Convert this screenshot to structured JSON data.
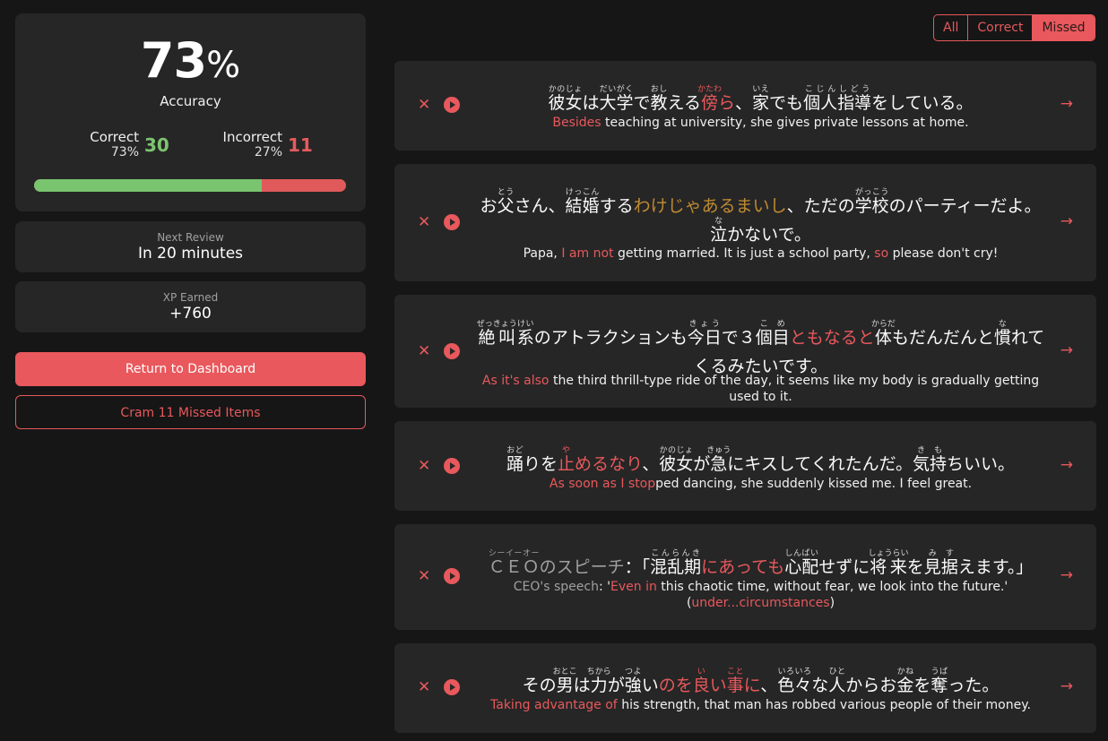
{
  "summary": {
    "accuracy_number": "73",
    "accuracy_sign": "%",
    "accuracy_label": "Accuracy",
    "correct_label": "Correct",
    "correct_pct": "73%",
    "correct_count": "30",
    "incorrect_label": "Incorrect",
    "incorrect_pct": "27%",
    "incorrect_count": "11",
    "bar_correct_fraction": 0.73
  },
  "next_review": {
    "label": "Next Review",
    "value": "In 20 minutes"
  },
  "xp": {
    "label": "XP Earned",
    "value": "+760"
  },
  "buttons": {
    "dashboard": "Return to Dashboard",
    "cram": "Cram 11 Missed Items"
  },
  "filters": {
    "all": "All",
    "correct": "Correct",
    "missed": "Missed",
    "active": "Missed"
  },
  "icons": {
    "remove": "close-icon",
    "play": "play-icon",
    "open": "arrow-right-icon"
  },
  "colors": {
    "accent": "#e8585c",
    "correct": "#7dc471",
    "grammar_highlight": "#c08a32",
    "panel": "#262626",
    "background": "#161616"
  },
  "cards": [
    {
      "jp": [
        {
          "r": "彼女",
          "rt": "かのじょ"
        },
        {
          "t": "は"
        },
        {
          "r": "大学",
          "rt": "だいがく"
        },
        {
          "t": "で"
        },
        {
          "r": "教",
          "rt": "おし"
        },
        {
          "t": "える"
        },
        {
          "r": "傍",
          "rt": "かたわ",
          "hl": 1
        },
        {
          "t": "ら",
          "hl": 1
        },
        {
          "t": "、"
        },
        {
          "r": "家",
          "rt": "いえ"
        },
        {
          "t": "でも"
        },
        {
          "r": "個人指導",
          "rt": "こじんしどう"
        },
        {
          "t": "をしている。"
        }
      ],
      "en": [
        {
          "t": "Besides",
          "hl": 1
        },
        {
          "t": " teaching at university, she gives private lessons at home."
        }
      ]
    },
    {
      "jp": [
        {
          "t": "お"
        },
        {
          "r": "父",
          "rt": "とう"
        },
        {
          "t": "さん、"
        },
        {
          "r": "結婚",
          "rt": "けっこん"
        },
        {
          "t": "する"
        },
        {
          "t": "わけじゃあるまいし",
          "hl": 2
        },
        {
          "t": "、ただの"
        },
        {
          "r": "学校",
          "rt": "がっこう"
        },
        {
          "t": "のパーティーだよ。"
        },
        {
          "r": "泣",
          "rt": "な"
        },
        {
          "t": "かないで。"
        }
      ],
      "en": [
        {
          "t": "Papa, "
        },
        {
          "t": "I am not",
          "hl": 1
        },
        {
          "t": " getting married. It is just a school party, "
        },
        {
          "t": "so",
          "hl": 1
        },
        {
          "t": " please don't cry!"
        }
      ]
    },
    {
      "jp": [
        {
          "r": "絶叫",
          "rt": "ぜっきょう"
        },
        {
          "r": "系",
          "rt": "けい"
        },
        {
          "t": "のアトラクションも"
        },
        {
          "r": "今日",
          "rt": "きょう"
        },
        {
          "t": "で３"
        },
        {
          "r": "個目",
          "rt": "こめ"
        },
        {
          "t": "ともなると",
          "hl": 1
        },
        {
          "r": "体",
          "rt": "からだ"
        },
        {
          "t": "もだんだんと"
        },
        {
          "r": "慣",
          "rt": "な"
        },
        {
          "t": "れてくるみたいです。"
        }
      ],
      "en": [
        {
          "t": "As it's also",
          "hl": 1
        },
        {
          "t": " the third thrill-type ride of the day, it seems like my body is gradually getting used to it."
        }
      ]
    },
    {
      "jp": [
        {
          "r": "踊",
          "rt": "おど"
        },
        {
          "t": "りを"
        },
        {
          "r": "止",
          "rt": "や",
          "hl": 1
        },
        {
          "t": "めるなり",
          "hl": 1
        },
        {
          "t": "、"
        },
        {
          "r": "彼女",
          "rt": "かのじょ"
        },
        {
          "t": "が"
        },
        {
          "r": "急",
          "rt": "きゅう"
        },
        {
          "t": "にキスしてくれたんだ。"
        },
        {
          "r": "気持",
          "rt": "きも"
        },
        {
          "t": "ちいい。"
        }
      ],
      "en": [
        {
          "t": "As soon as I stop",
          "hl": 1
        },
        {
          "t": "ped dancing, she suddenly kissed me. I feel great."
        }
      ]
    },
    {
      "jp": [
        {
          "r": "ＣＥＯ",
          "rt": "シーイーオー",
          "dim": 1
        },
        {
          "t": "のスピーチ",
          "dim": 1
        },
        {
          "t": "：「"
        },
        {
          "r": "混乱期",
          "rt": "こんらんき"
        },
        {
          "t": "にあっても",
          "hl": 1
        },
        {
          "r": "心配",
          "rt": "しんぱい"
        },
        {
          "t": "せずに"
        },
        {
          "r": "将来",
          "rt": "しょうらい"
        },
        {
          "t": "を"
        },
        {
          "r": "見",
          "rt": "み"
        },
        {
          "r": "据",
          "rt": "す"
        },
        {
          "t": "えます。」"
        }
      ],
      "en": [
        {
          "t": "CEO's speech",
          "dim": 1
        },
        {
          "t": ": '"
        },
        {
          "t": "Even in",
          "hl": 1
        },
        {
          "t": " this chaotic time, without fear, we look into the future.' ("
        },
        {
          "t": "under...circumstances",
          "hl": 1
        },
        {
          "t": ")"
        }
      ]
    },
    {
      "jp": [
        {
          "t": "その"
        },
        {
          "r": "男",
          "rt": "おとこ"
        },
        {
          "t": "は"
        },
        {
          "r": "力",
          "rt": "ちから"
        },
        {
          "t": "が"
        },
        {
          "r": "強",
          "rt": "つよ"
        },
        {
          "t": "い"
        },
        {
          "t": "のを",
          "hl": 1
        },
        {
          "r": "良",
          "rt": "い",
          "hl": 1
        },
        {
          "t": "い",
          "hl": 1
        },
        {
          "r": "事",
          "rt": "こと",
          "hl": 1
        },
        {
          "t": "に",
          "hl": 1
        },
        {
          "t": "、"
        },
        {
          "r": "色々",
          "rt": "いろいろ"
        },
        {
          "t": "な"
        },
        {
          "r": "人",
          "rt": "ひと"
        },
        {
          "t": "からお"
        },
        {
          "r": "金",
          "rt": "かね"
        },
        {
          "t": "を"
        },
        {
          "r": "奪",
          "rt": "うば"
        },
        {
          "t": "った。"
        }
      ],
      "en": [
        {
          "t": "Taking advantage of",
          "hl": 1
        },
        {
          "t": " his strength, that man has robbed various people of their money."
        }
      ]
    }
  ]
}
